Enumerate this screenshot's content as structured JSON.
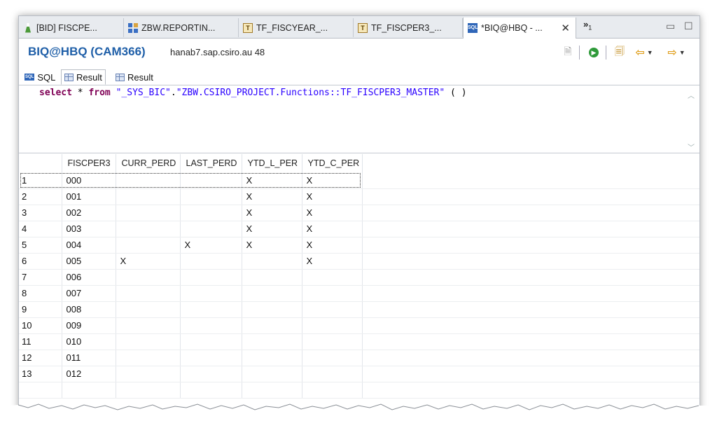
{
  "tabs": [
    {
      "label": "[BID] FISCPE...",
      "icon": "beaker-icon"
    },
    {
      "label": "ZBW.REPORTIN...",
      "icon": "grid-icon"
    },
    {
      "label": "TF_FISCYEAR_...",
      "icon": "table-function-icon"
    },
    {
      "label": "TF_FISCPER3_...",
      "icon": "table-function-icon"
    },
    {
      "label": "*BIQ@HBQ - ...",
      "icon": "sql-icon",
      "active": true
    }
  ],
  "overflow": {
    "chevron": "»",
    "count": "1"
  },
  "header": {
    "title": "BIQ@HBQ (CAM366)",
    "host": "hanab7.sap.csiro.au 48"
  },
  "inner_tabs": [
    {
      "label": "SQL",
      "icon": "sql-icon"
    },
    {
      "label": "Result",
      "icon": "result-icon",
      "active": true
    },
    {
      "label": "Result",
      "icon": "result-icon"
    }
  ],
  "sql": {
    "kw_select": "select",
    "star": " * ",
    "kw_from": "from",
    "sp": " ",
    "schema": "\"_SYS_BIC\"",
    "dot": ".",
    "object": "\"ZBW.CSIRO_PROJECT.Functions::TF_FISCPER3_MASTER\"",
    "args": " ( )"
  },
  "result": {
    "columns": [
      "",
      "FISCPER3",
      "CURR_PERD",
      "LAST_PERD",
      "YTD_L_PER",
      "YTD_C_PER"
    ],
    "rows": [
      [
        "1",
        "000",
        "",
        "",
        "X",
        "X"
      ],
      [
        "2",
        "001",
        "",
        "",
        "X",
        "X"
      ],
      [
        "3",
        "002",
        "",
        "",
        "X",
        "X"
      ],
      [
        "4",
        "003",
        "",
        "",
        "X",
        "X"
      ],
      [
        "5",
        "004",
        "",
        "X",
        "X",
        "X"
      ],
      [
        "6",
        "005",
        "X",
        "",
        "",
        "X"
      ],
      [
        "7",
        "006",
        "",
        "",
        "",
        ""
      ],
      [
        "8",
        "007",
        "",
        "",
        "",
        ""
      ],
      [
        "9",
        "008",
        "",
        "",
        "",
        ""
      ],
      [
        "10",
        "009",
        "",
        "",
        "",
        ""
      ],
      [
        "11",
        "010",
        "",
        "",
        "",
        ""
      ],
      [
        "12",
        "011",
        "",
        "",
        "",
        ""
      ],
      [
        "13",
        "012",
        "",
        "",
        "",
        ""
      ]
    ]
  },
  "colors": {
    "title_blue": "#1f5fa8",
    "keyword": "#7f0055",
    "string": "#2a00ff",
    "run_green": "#2f9a3a"
  }
}
